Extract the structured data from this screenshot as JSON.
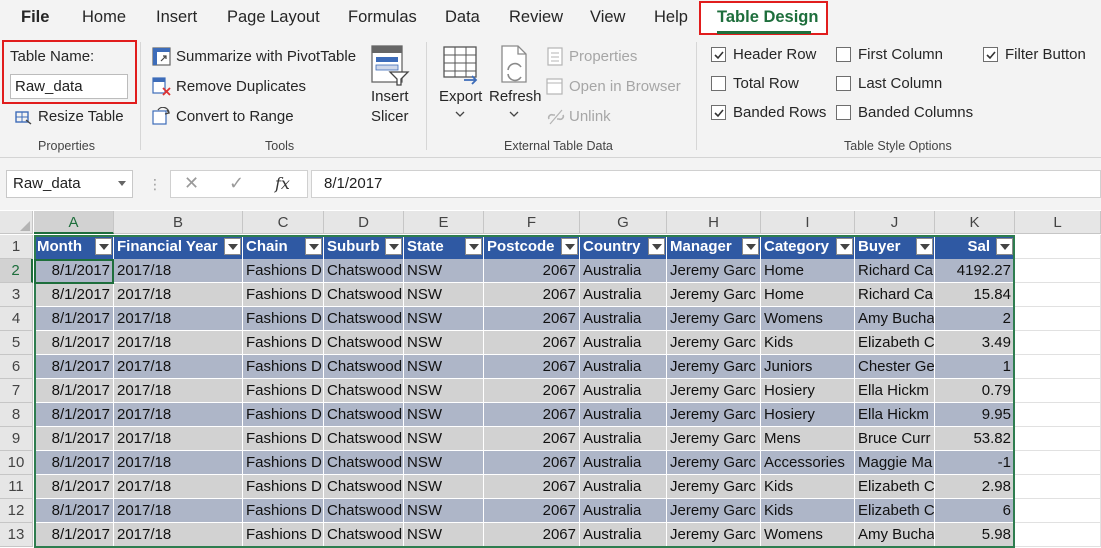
{
  "tabs": [
    "File",
    "Home",
    "Insert",
    "Page Layout",
    "Formulas",
    "Data",
    "Review",
    "View",
    "Help",
    "Table Design"
  ],
  "active_tab": "Table Design",
  "ribbon": {
    "properties": {
      "table_name_label": "Table Name:",
      "table_name_value": "Raw_data",
      "resize_table": "Resize Table",
      "group_label": "Properties"
    },
    "tools": {
      "summarize_pivot": "Summarize with PivotTable",
      "remove_duplicates": "Remove Duplicates",
      "convert_to_range": "Convert to Range",
      "insert_slicer_line1": "Insert",
      "insert_slicer_line2": "Slicer",
      "group_label": "Tools"
    },
    "external": {
      "export": "Export",
      "refresh": "Refresh",
      "properties": "Properties",
      "open_in_browser": "Open in Browser",
      "unlink": "Unlink",
      "group_label": "External Table Data"
    },
    "style_options": {
      "header_row": "Header Row",
      "total_row": "Total Row",
      "banded_rows": "Banded Rows",
      "first_column": "First Column",
      "last_column": "Last Column",
      "banded_columns": "Banded Columns",
      "filter_button": "Filter Button",
      "group_label": "Table Style Options",
      "checked": {
        "header_row": true,
        "total_row": false,
        "banded_rows": true,
        "first_column": false,
        "last_column": false,
        "banded_columns": false,
        "filter_button": true
      }
    }
  },
  "formula_bar": {
    "name_box": "Raw_data",
    "cancel_symbol": "✕",
    "enter_symbol": "✓",
    "fx_label": "fx",
    "value": "8/1/2017"
  },
  "sheet": {
    "column_letters": [
      "A",
      "B",
      "C",
      "D",
      "E",
      "F",
      "G",
      "H",
      "I",
      "J",
      "K",
      "L"
    ],
    "row_numbers": [
      "1",
      "2",
      "3",
      "4",
      "5",
      "6",
      "7",
      "8",
      "9",
      "10",
      "11",
      "12",
      "13"
    ],
    "selected_cell": "A2",
    "headers": [
      "Month",
      "Financial Year",
      "Chain",
      "Suburb",
      "State",
      "Postcode",
      "Country",
      "Manager",
      "Category",
      "Buyer",
      "Sal"
    ],
    "rows": [
      [
        "8/1/2017",
        "2017/18",
        "Fashions D",
        "Chatswood",
        "NSW",
        "2067",
        "Australia",
        "Jeremy Garc",
        "Home",
        "Richard Ca",
        "4192.27"
      ],
      [
        "8/1/2017",
        "2017/18",
        "Fashions D",
        "Chatswood",
        "NSW",
        "2067",
        "Australia",
        "Jeremy Garc",
        "Home",
        "Richard Ca",
        "15.84"
      ],
      [
        "8/1/2017",
        "2017/18",
        "Fashions D",
        "Chatswood",
        "NSW",
        "2067",
        "Australia",
        "Jeremy Garc",
        "Womens",
        "Amy Bucha",
        "2"
      ],
      [
        "8/1/2017",
        "2017/18",
        "Fashions D",
        "Chatswood",
        "NSW",
        "2067",
        "Australia",
        "Jeremy Garc",
        "Kids",
        "Elizabeth C",
        "3.49"
      ],
      [
        "8/1/2017",
        "2017/18",
        "Fashions D",
        "Chatswood",
        "NSW",
        "2067",
        "Australia",
        "Jeremy Garc",
        "Juniors",
        "Chester Ge",
        "1"
      ],
      [
        "8/1/2017",
        "2017/18",
        "Fashions D",
        "Chatswood",
        "NSW",
        "2067",
        "Australia",
        "Jeremy Garc",
        "Hosiery",
        "Ella Hickm",
        "0.79"
      ],
      [
        "8/1/2017",
        "2017/18",
        "Fashions D",
        "Chatswood",
        "NSW",
        "2067",
        "Australia",
        "Jeremy Garc",
        "Hosiery",
        "Ella Hickm",
        "9.95"
      ],
      [
        "8/1/2017",
        "2017/18",
        "Fashions D",
        "Chatswood",
        "NSW",
        "2067",
        "Australia",
        "Jeremy Garc",
        "Mens",
        "Bruce Curr",
        "53.82"
      ],
      [
        "8/1/2017",
        "2017/18",
        "Fashions D",
        "Chatswood",
        "NSW",
        "2067",
        "Australia",
        "Jeremy Garc",
        "Accessories",
        "Maggie Ma",
        "-1"
      ],
      [
        "8/1/2017",
        "2017/18",
        "Fashions D",
        "Chatswood",
        "NSW",
        "2067",
        "Australia",
        "Jeremy Garc",
        "Kids",
        "Elizabeth C",
        "2.98"
      ],
      [
        "8/1/2017",
        "2017/18",
        "Fashions D",
        "Chatswood",
        "NSW",
        "2067",
        "Australia",
        "Jeremy Garc",
        "Kids",
        "Elizabeth C",
        "6"
      ],
      [
        "8/1/2017",
        "2017/18",
        "Fashions D",
        "Chatswood",
        "NSW",
        "2067",
        "Australia",
        "Jeremy Garc",
        "Womens",
        "Amy Bucha",
        "5.98"
      ]
    ]
  },
  "colors": {
    "accent_green": "#1e6e3c",
    "highlight_red": "#e11d1d",
    "table_header": "#2f59a3",
    "band_dark": "#aeb6c8",
    "band_light": "#d2d2d2"
  }
}
